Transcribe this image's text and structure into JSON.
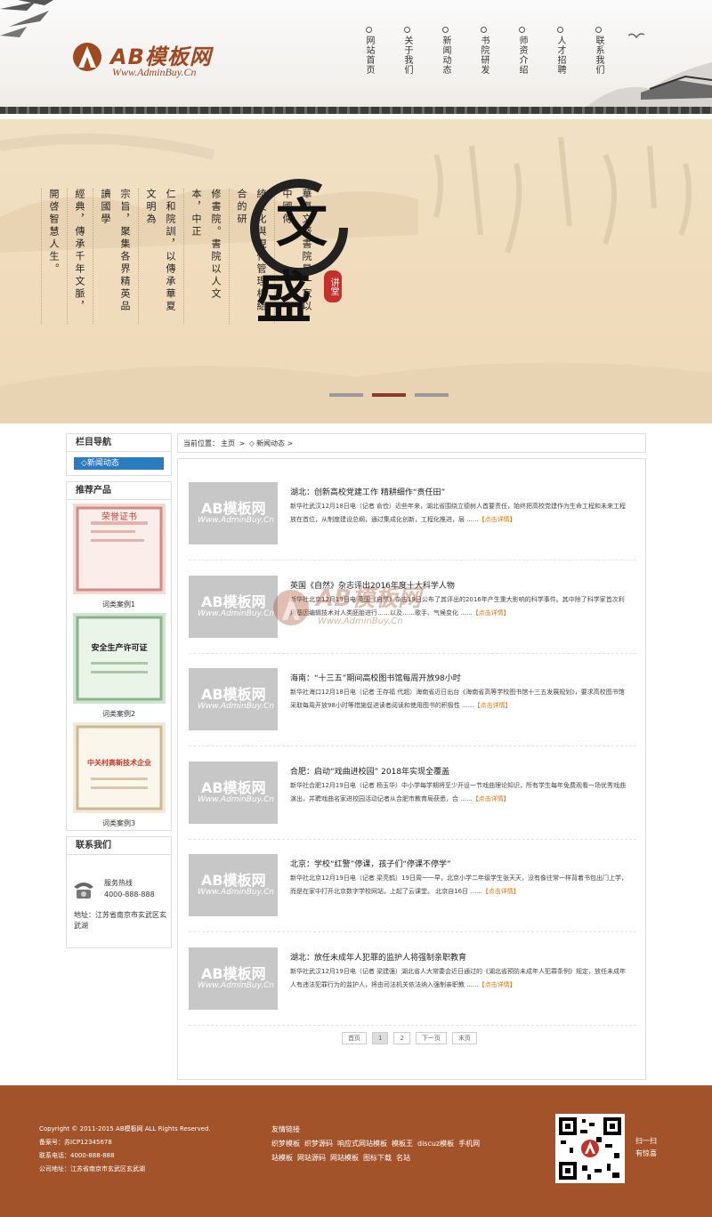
{
  "header": {
    "brand": "AB模板网",
    "brand_url": "Www.AdminBuy.Cn",
    "nav": [
      "网站首页",
      "关于我们",
      "新闻动态",
      "书院研发",
      "师资介绍",
      "人才招聘",
      "联系我们"
    ]
  },
  "banner": {
    "poem_cols": [
      "華夏文盛書院是一家以中國傳",
      "統文化與現代管理相結合的研",
      "修書院。書院以人文本，中正",
      "仁和院訓，以傳承華夏文明為",
      "宗旨，聚集各界精英品讀國學",
      "經典，傳承千年文脈，",
      "開啓智慧人生。"
    ],
    "big_char_1": "文",
    "big_char_2": "盛",
    "seal_text": "讲堂",
    "active_slide": 2,
    "slide_count": 3
  },
  "sidebar": {
    "nav_title": "栏目导航",
    "category": "新闻动态",
    "products_title": "推荐产品",
    "products": [
      {
        "caption": "词类案例1",
        "cert_title": "荣誉证书"
      },
      {
        "caption": "词类案例2",
        "cert_title": "安全生产许可证"
      },
      {
        "caption": "词类案例3",
        "cert_title": "中关村高新技术企业"
      }
    ],
    "contact_title": "联系我们",
    "hotline_label": "服务热线",
    "hotline": "4000-888-888",
    "address": "地址：江苏省南京市玄武区玄武湖"
  },
  "breadcrumb": {
    "label": "当前位置：",
    "home": "主页",
    "sep": " > ",
    "current": "新闻动态 >"
  },
  "thumb_text": {
    "t1": "AB模板网",
    "t2": "Www.AdminBuy.Cn"
  },
  "news": [
    {
      "title": "湖北：创新高校党建工作 精耕细作“责任田”",
      "desc": "新华社武汉12月18日电（记者 俞俭）近些年来，湖北省围绕立德树人首要责任，始终把高校党建作为生命工程和未来工程放在首位，从制度建设总纲，通过集成化创新，工程化推进，层 ......",
      "more": "【点击详情】"
    },
    {
      "title": "英国《自然》杂志评出2016年度十大科学人物",
      "desc": "新华社北京12月19日电 英国《自然》杂志19日公布了其评出的2016年产生重大影响的科学事件。其中除了科学家首次利用基因编辑技术对人类胚胎进行……以及……歌手、气候变化 ......",
      "more": "【点击详情】"
    },
    {
      "title": "海南：“十三五”期间高校图书馆每周开放98小时",
      "desc": "新华社海口12月18日电（记者 王存福 代超）海南省近日出台《海南省高等学校图书馆十三五发展规划》，要求高校图书馆采取每周开放98小时等措施促进读者阅读和使用图书的积极性 ......",
      "more": "【点击详情】"
    },
    {
      "title": "合肥：启动“戏曲进校园” 2018年实现全覆盖",
      "desc": "新华社合肥12月19日电（记者 杨玉华）中小学每学期将至少开设一节戏曲理论知识，所有学生每年免费观看一场优秀戏曲演出，并聘戏曲名家进校园活动记者从合肥市教育局获悉，合 ......",
      "more": "【点击详情】"
    },
    {
      "title": "北京：学校“红警”停课，孩子们“停课不停学”",
      "desc": "新华社北京12月19日电（记者 梁亮鹤）19日周一一早，北京小学二年级学生张天天，没有像往常一样背着书包出门上学，而是在家中打开北京数字学校网站，上起了云课堂。 北京自16日 ......",
      "more": "【点击详情】"
    },
    {
      "title": "湖北：放任未成年人犯罪的监护人将强制亲职教育",
      "desc": "新华社武汉12月19日电（记者 梁建强）湖北省人大常委会近日通过的《湖北省预防未成年人犯罪条例》规定，放任未成年人有违法犯罪行为的监护人，将由司法机关依法纳入强制亲职教 ......",
      "more": "【点击详情】"
    }
  ],
  "pager": {
    "first": "首页",
    "p1": "1",
    "p2": "2",
    "next": "下一页",
    "last": "末页"
  },
  "footer": {
    "copyright": "Copyright © 2011-2015 AB模板网 ALL Rights Reserved.",
    "icp": "备案号：苏ICP12345678",
    "tel": "联系电话：4000-888-888",
    "addr": "公司地址：江苏省南京市玄武区玄武湖",
    "links_title": "友情链接",
    "links": [
      "织梦模板",
      "织梦源码",
      "响应式网站模板",
      "模板王",
      "discuz模板",
      "手机网站模板",
      "网站源码",
      "网站模板",
      "图标下载",
      "名站"
    ],
    "qr_text_1": "扫一扫",
    "qr_text_2": "有惊喜"
  },
  "colors": {
    "brand": "#a04820",
    "footer": "#a3532a",
    "accent_blue": "#2b7bbf",
    "more": "#e07000"
  }
}
